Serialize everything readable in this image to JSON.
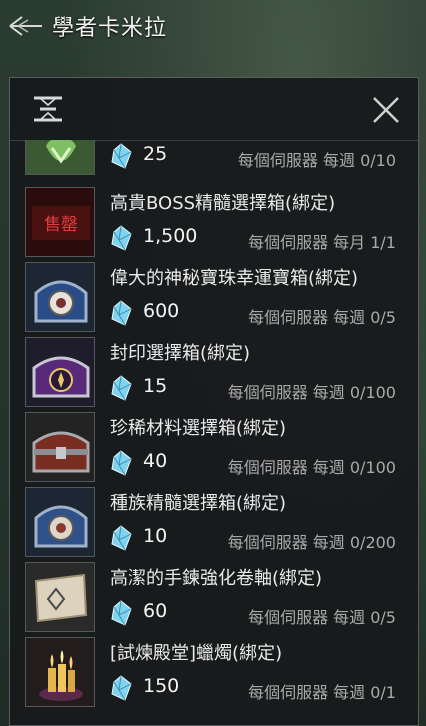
{
  "header": {
    "title": "學者卡米拉"
  },
  "colors": {
    "panel_bg": "#18191b",
    "gem_blue": "#7fd3ee",
    "red_label": "#c82a2a"
  },
  "items": [
    {
      "name": "",
      "price": "25",
      "limit": "每個伺服器 每週 0/10",
      "icon": "green-pouch-icon"
    },
    {
      "name": "高貴BOSS精髓選擇箱(綁定)",
      "price": "1,500",
      "limit": "每個伺服器 每月 1/1",
      "icon": "sold-out-icon",
      "badge": "售罄"
    },
    {
      "name": "偉大的神秘寶珠幸運寶箱(綁定)",
      "price": "600",
      "limit": "每個伺服器 每週 0/5",
      "icon": "blue-orb-chest-icon"
    },
    {
      "name": "封印選擇箱(綁定)",
      "price": "15",
      "limit": "每個伺服器 每週 0/100",
      "icon": "purple-chest-icon"
    },
    {
      "name": "珍稀材料選擇箱(綁定)",
      "price": "40",
      "limit": "每個伺服器 每週 0/100",
      "icon": "red-chest-icon"
    },
    {
      "name": "種族精髓選擇箱(綁定)",
      "price": "10",
      "limit": "每個伺服器 每週 0/200",
      "icon": "blue-chest-icon"
    },
    {
      "name": "高潔的手鍊強化卷軸(綁定)",
      "price": "60",
      "limit": "每個伺服器 每週 0/5",
      "icon": "scroll-icon"
    },
    {
      "name": "[試煉殿堂]蠟燭(綁定)",
      "price": "150",
      "limit": "每個伺服器 每週 0/1",
      "icon": "candle-icon"
    }
  ]
}
